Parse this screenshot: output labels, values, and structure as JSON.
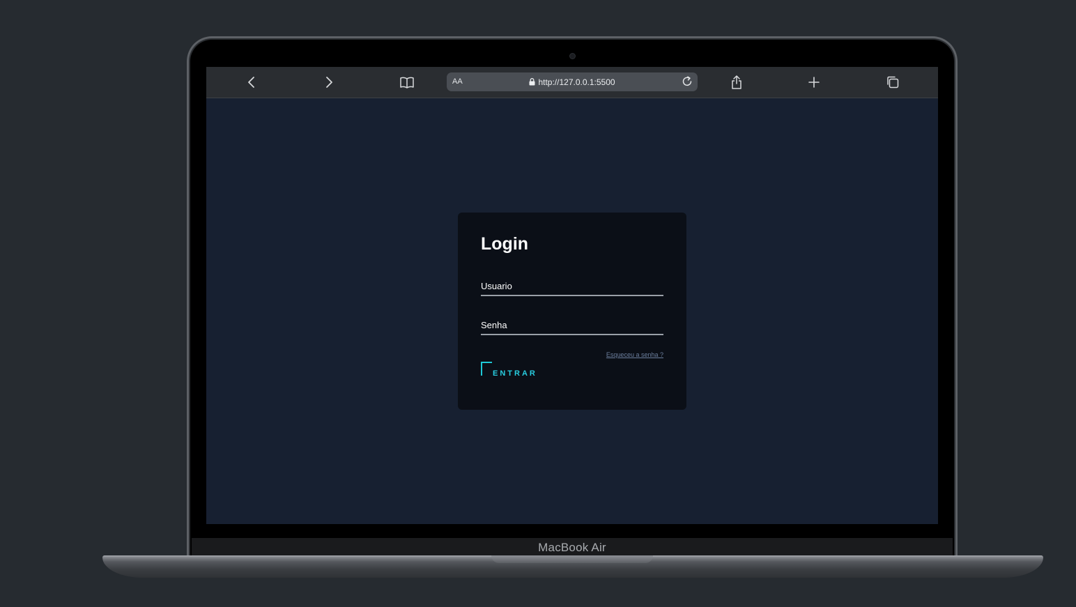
{
  "device": {
    "name": "MacBook Air"
  },
  "browser": {
    "url": "http://127.0.0.1:5500",
    "text_size_label": "AA",
    "icons": [
      "back-icon",
      "forward-icon",
      "bookmarks-icon",
      "lock-icon",
      "reload-icon",
      "share-icon",
      "new-tab-icon",
      "tabs-icon"
    ]
  },
  "login": {
    "title": "Login",
    "username_label": "Usuario",
    "password_label": "Senha",
    "forgot_link": "Esqueceu a senha ?",
    "submit_label": "ENTRAR"
  },
  "colors": {
    "page_bg": "#172031",
    "card_bg": "#0b0f17",
    "accent": "#1ec8d6",
    "link": "#6c7f9e"
  }
}
